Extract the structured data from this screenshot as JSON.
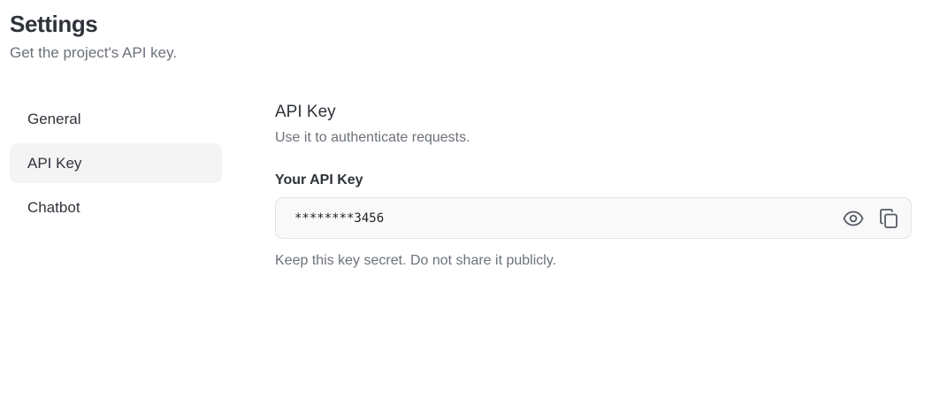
{
  "header": {
    "title": "Settings",
    "subtitle": "Get the project's API key."
  },
  "sidebar": {
    "items": [
      {
        "label": "General",
        "active": false
      },
      {
        "label": "API Key",
        "active": true
      },
      {
        "label": "Chatbot",
        "active": false
      }
    ]
  },
  "main": {
    "section_title": "API Key",
    "section_description": "Use it to authenticate requests.",
    "field_label": "Your API Key",
    "api_key_value": "********3456",
    "helper_text": "Keep this key secret. Do not share it publicly.",
    "icons": {
      "reveal": "eye-icon",
      "copy": "copy-icon"
    }
  },
  "colors": {
    "active_item_bg": "#f4f4f5",
    "muted_text": "#6c717a",
    "field_bg": "#f9f9fa",
    "field_border": "#e1e3e6"
  }
}
